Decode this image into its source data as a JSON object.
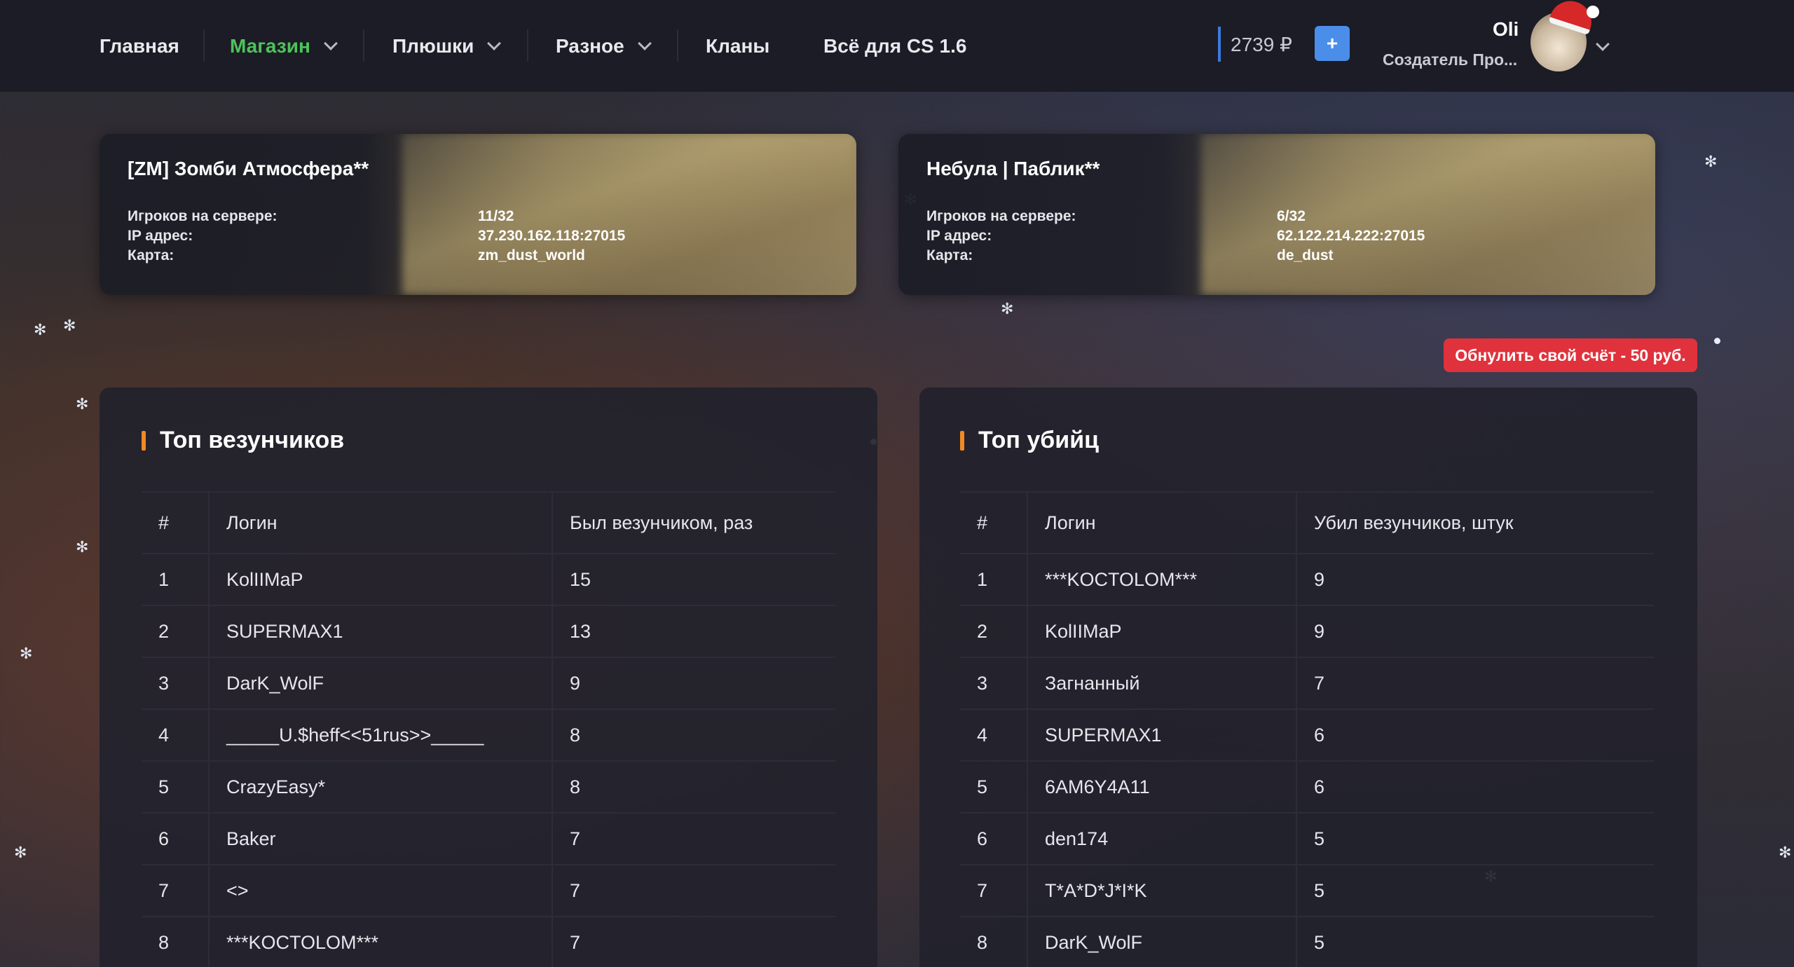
{
  "nav": {
    "items": [
      {
        "label": "Главная",
        "dropdown": false
      },
      {
        "label": "Магазин",
        "dropdown": true,
        "active": true
      },
      {
        "label": "Плюшки",
        "dropdown": true
      },
      {
        "label": "Разное",
        "dropdown": true
      },
      {
        "label": "Кланы",
        "dropdown": false
      },
      {
        "label": "Всё для CS 1.6",
        "dropdown": false
      }
    ],
    "balance": "2739 ₽",
    "add_funds_label": "+",
    "user": {
      "name": "Oli",
      "role": "Создатель Про..."
    }
  },
  "servers": [
    {
      "title": "[ZM] Зомби Атмосфера**",
      "players_label": "Игроков на сервере:",
      "players": "11/32",
      "ip_label": "IP адрес:",
      "ip": "37.230.162.118:27015",
      "map_label": "Карта:",
      "map": "zm_dust_world"
    },
    {
      "title": "Небула | Паблик**",
      "players_label": "Игроков на сервере:",
      "players": "6/32",
      "ip_label": "IP адрес:",
      "ip": "62.122.214.222:27015",
      "map_label": "Карта:",
      "map": "de_dust"
    }
  ],
  "reset_button": "Обнулить свой счёт - 50 руб.",
  "lucky": {
    "title": "Топ везунчиков",
    "columns": [
      "#",
      "Логин",
      "Был везунчиком, раз"
    ],
    "rows": [
      [
        "1",
        "KolIIMaP",
        "15"
      ],
      [
        "2",
        "SUPERMAX1",
        "13"
      ],
      [
        "3",
        "DarK_WolF",
        "9"
      ],
      [
        "4",
        "_____U.$heff<<51rus>>_____",
        "8"
      ],
      [
        "5",
        "CrazyEasy*",
        "8"
      ],
      [
        "6",
        "Baker",
        "7"
      ],
      [
        "7",
        "<>",
        "7"
      ],
      [
        "8",
        "***KOCTOLOM***",
        "7"
      ]
    ]
  },
  "killers": {
    "title": "Топ убийц",
    "columns": [
      "#",
      "Логин",
      "Убил везунчиков, штук"
    ],
    "rows": [
      [
        "1",
        "***KOCTOLOM***",
        "9"
      ],
      [
        "2",
        "KolIIMaP",
        "9"
      ],
      [
        "3",
        "Загнанный",
        "7"
      ],
      [
        "4",
        "SUPERMAX1",
        "6"
      ],
      [
        "5",
        "6AM6Y4A11",
        "6"
      ],
      [
        "6",
        "den174",
        "5"
      ],
      [
        "7",
        "T*A*D*J*I*K",
        "5"
      ],
      [
        "8",
        "DarK_WolF",
        "5"
      ]
    ]
  },
  "colors": {
    "active_nav": "#4ec25a",
    "accent_bar": "#f08a24",
    "reset": "#e0323c",
    "plus": "#4a8eea"
  }
}
